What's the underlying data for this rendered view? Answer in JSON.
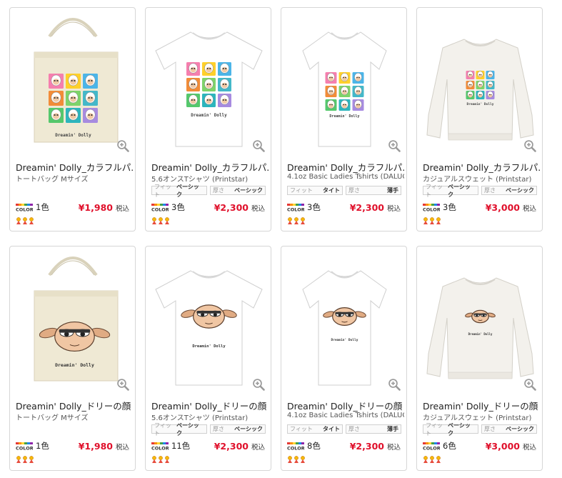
{
  "colors": {
    "price": "#e0102b",
    "border": "#d6d6d6",
    "shirt": "#ffffff",
    "tote": "#efe9d4",
    "sweat": "#f3f1ec"
  },
  "rows": [
    {
      "products": [
        {
          "type": "tote",
          "design": "grid",
          "title": "Dreamin' Dolly_カラフルパ...",
          "subtitle": "トートバッグ Mサイズ",
          "specs": [],
          "colors": "1色",
          "price": "¥1,980",
          "tax": "税込"
        },
        {
          "type": "tshirt",
          "design": "grid",
          "title": "Dreamin' Dolly_カラフルパ...",
          "subtitle": "5.6オンスTシャツ (Printstar)",
          "specs": [
            {
              "k": "フィット",
              "v": "ベーシック"
            },
            {
              "k": "厚さ",
              "v": "ベーシック"
            }
          ],
          "colors": "3色",
          "price": "¥2,300",
          "tax": "税込"
        },
        {
          "type": "ladies",
          "design": "grid",
          "title": "Dreamin' Dolly_カラフルパ...",
          "subtitle": "4.1oz Basic Ladies Tshirts (DALUC)",
          "specs": [
            {
              "k": "フィット",
              "v": "タイト"
            },
            {
              "k": "厚さ",
              "v": "薄手"
            }
          ],
          "colors": "3色",
          "price": "¥2,300",
          "tax": "税込"
        },
        {
          "type": "sweat",
          "design": "grid",
          "title": "Dreamin' Dolly_カラフルパ...",
          "subtitle": "カジュアルスウェット (Printstar)",
          "specs": [
            {
              "k": "フィット",
              "v": "ベーシック"
            },
            {
              "k": "厚さ",
              "v": "ベーシック"
            }
          ],
          "colors": "3色",
          "price": "¥3,000",
          "tax": "税込"
        }
      ]
    },
    {
      "products": [
        {
          "type": "tote",
          "design": "face",
          "title": "Dreamin' Dolly_ドリーの顔",
          "subtitle": "トートバッグ Mサイズ",
          "specs": [],
          "colors": "1色",
          "price": "¥1,980",
          "tax": "税込"
        },
        {
          "type": "tshirt",
          "design": "face",
          "title": "Dreamin' Dolly_ドリーの顔",
          "subtitle": "5.6オンスTシャツ (Printstar)",
          "specs": [
            {
              "k": "フィット",
              "v": "ベーシック"
            },
            {
              "k": "厚さ",
              "v": "ベーシック"
            }
          ],
          "colors": "11色",
          "price": "¥2,300",
          "tax": "税込"
        },
        {
          "type": "ladies",
          "design": "face",
          "title": "Dreamin' Dolly_ドリーの顔",
          "subtitle": "4.1oz Basic Ladies Tshirts (DALUC)",
          "specs": [
            {
              "k": "フィット",
              "v": "タイト"
            },
            {
              "k": "厚さ",
              "v": "薄手"
            }
          ],
          "colors": "8色",
          "price": "¥2,300",
          "tax": "税込"
        },
        {
          "type": "sweat",
          "design": "face",
          "title": "Dreamin' Dolly_ドリーの顔",
          "subtitle": "カジュアルスウェット (Printstar)",
          "specs": [
            {
              "k": "フィット",
              "v": "ベーシック"
            },
            {
              "k": "厚さ",
              "v": "ベーシック"
            }
          ],
          "colors": "6色",
          "price": "¥3,000",
          "tax": "税込"
        }
      ]
    }
  ],
  "design_text": "Dreamin' Dolly",
  "color_logo_text": "COLOR:",
  "rating_icons": 3
}
